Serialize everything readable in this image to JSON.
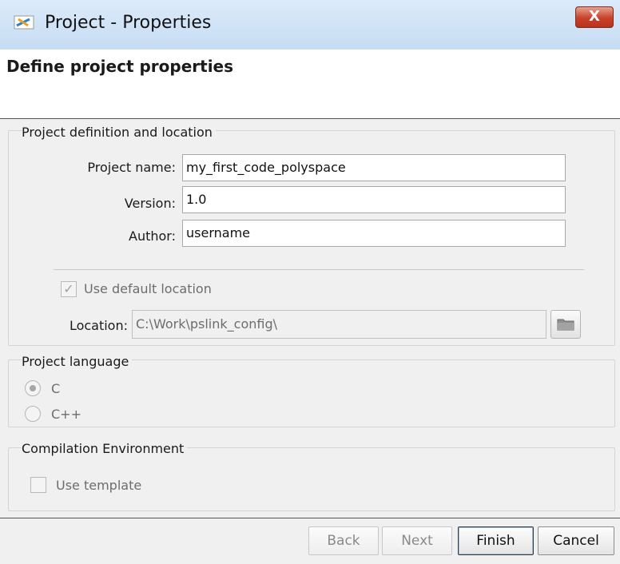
{
  "window": {
    "title": "Project - Properties",
    "close_label": "X"
  },
  "header": {
    "title": "Define project properties"
  },
  "definition": {
    "section_title": "Project definition and location",
    "project_name_label": "Project name:",
    "project_name_value": "my_first_code_polyspace",
    "version_label": "Version:",
    "version_value": "1.0",
    "author_label": "Author:",
    "author_value": "username",
    "use_default_location_label": "Use default location",
    "use_default_location_checked": true,
    "location_label": "Location:",
    "location_value": "C:\\Work\\pslink_config\\"
  },
  "language": {
    "section_title": "Project language",
    "options": [
      "C",
      "C++"
    ],
    "selected": "C"
  },
  "compilation": {
    "section_title": "Compilation Environment",
    "use_template_label": "Use template",
    "use_template_checked": false
  },
  "buttons": {
    "back": "Back",
    "next": "Next",
    "finish": "Finish",
    "cancel": "Cancel"
  },
  "icons": {
    "app": "polyspace-app-icon",
    "close": "close-icon",
    "folder": "folder-icon",
    "check": "check-icon"
  }
}
